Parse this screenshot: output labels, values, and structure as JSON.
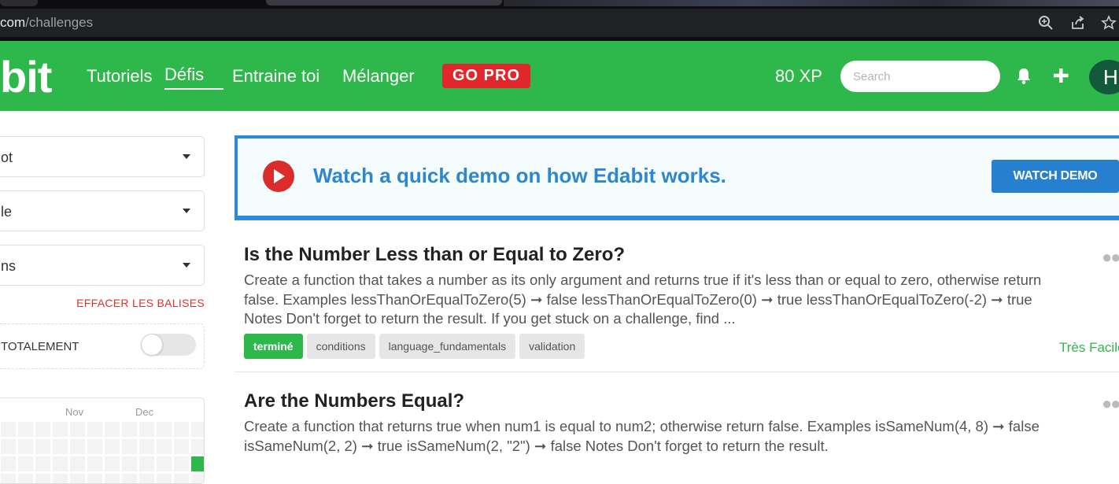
{
  "browser": {
    "url_domain": "com",
    "url_path": "/challenges",
    "icons": [
      "zoom-icon",
      "share-icon",
      "bookmark-star-icon"
    ]
  },
  "navbar": {
    "logo": "bit",
    "links": [
      "Tutoriels",
      "Défis",
      "Entraine toi",
      "Mélanger"
    ],
    "active_link": "Défis",
    "gopro": "GO PRO",
    "xp": "80 XP",
    "search_placeholder": "Search",
    "avatar_initial": "H",
    "brand_color": "#2eb84b"
  },
  "sidebar": {
    "selects": [
      "ot",
      "le",
      "ns"
    ],
    "clear_tags": "EFFACER LES BALISES",
    "toggle_label": "TOTALEMENT",
    "toggle_on": false,
    "heatmap_months": [
      "Nov",
      "Dec"
    ]
  },
  "demo_banner": {
    "text": "Watch a quick demo on how Edabit works.",
    "button": "WATCH DEMO"
  },
  "challenges": [
    {
      "title": "Is the Number Less than or Equal to Zero?",
      "description": "Create a function that takes a number as its only argument and returns true if it's less than or equal to zero, otherwise return false. Examples lessThanOrEqualToZero(5) ➞ false lessThanOrEqualToZero(0) ➞ true lessThanOrEqualToZero(-2) ➞ true Notes Don't forget to return the result. If you get stuck on a challenge, find ...",
      "tags": [
        "terminé",
        "conditions",
        "language_fundamentals",
        "validation"
      ],
      "difficulty": "Très Facile"
    },
    {
      "title": "Are the Numbers Equal?",
      "description": "Create a function that returns true when num1 is equal to num2; otherwise return false. Examples isSameNum(4, 8) ➞ false isSameNum(2, 2) ➞ true isSameNum(2, \"2\") ➞ false Notes Don't forget to return the result."
    }
  ]
}
